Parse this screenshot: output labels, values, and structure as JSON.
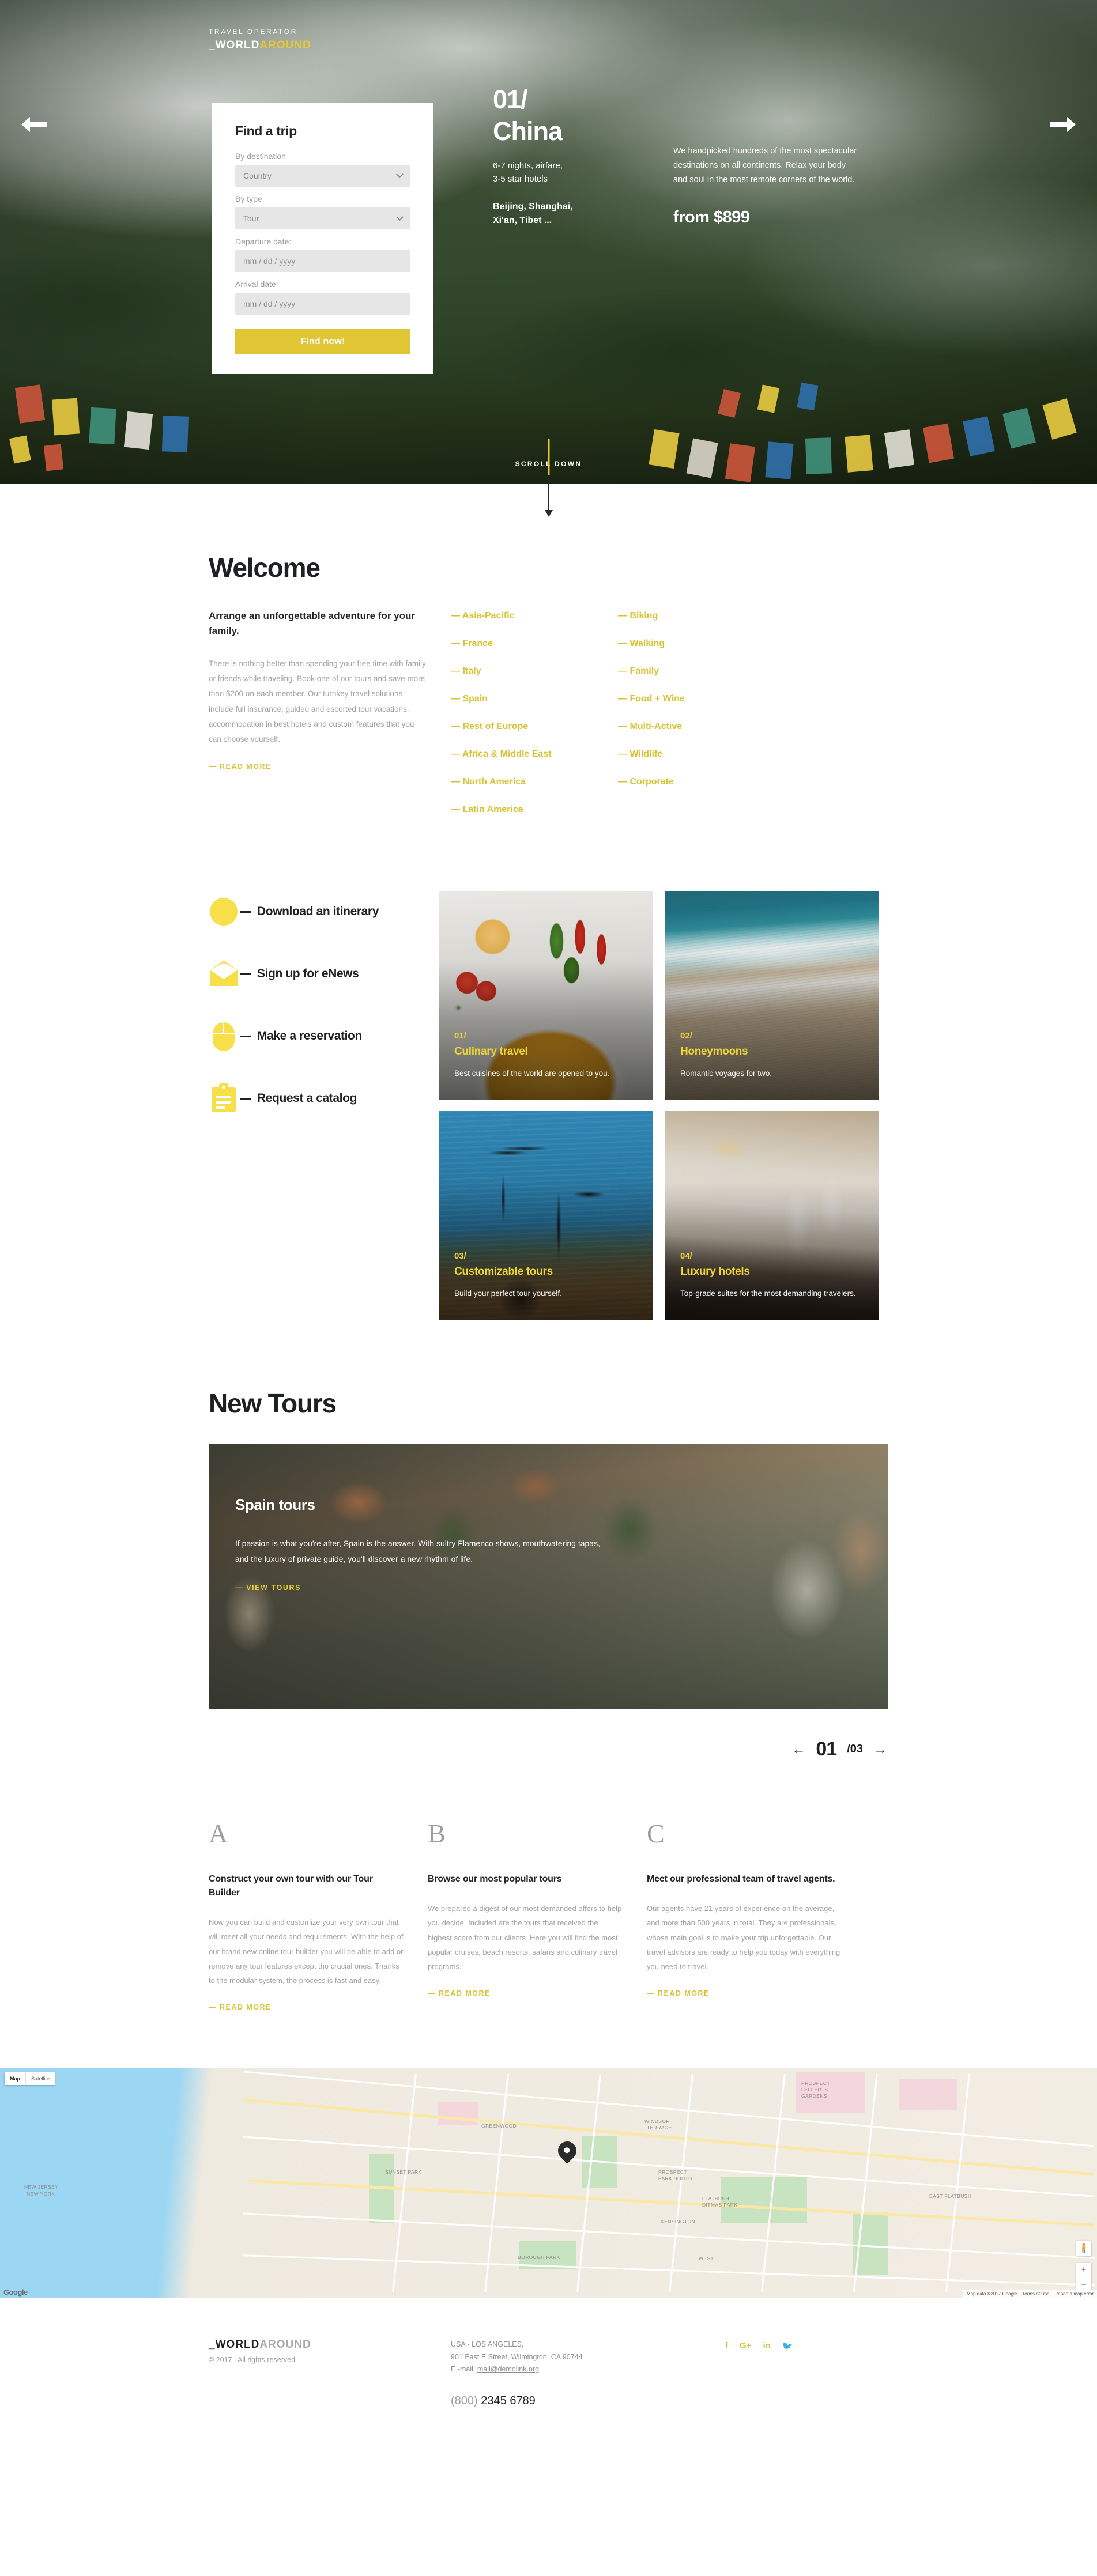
{
  "brand": {
    "kicker": "TRAVEL OPERATOR",
    "prefix": "_WORLD",
    "suffix": "AROUND"
  },
  "hero": {
    "prev_icon": "arrow-left-icon",
    "next_icon": "arrow-right-icon",
    "form": {
      "title": "Find a trip",
      "destination_label": "By destination",
      "destination_value": "Country",
      "type_label": "By type",
      "type_value": "Tour",
      "departure_label": "Departure date:",
      "departure_placeholder": "mm / dd / yyyy",
      "arrival_label": "Arrival date:",
      "arrival_placeholder": "mm / dd / yyyy",
      "submit": "Find now!"
    },
    "slide": {
      "number": "01/",
      "title": "China",
      "meta": "6-7 nights, airfare,\n3-5 star hotels",
      "cities": "Beijing, Shanghai,\nXi'an, Tibet ...",
      "description": "We handpicked hundreds of the most spectacular destinations on all continents. Relax your body and soul in the most remote corners of the world.",
      "price": "from $899"
    },
    "scroll_label": "SCROLL DOWN"
  },
  "welcome": {
    "heading": "Welcome",
    "subheading": "Arrange an unforgettable adventure for your family.",
    "body": "There is nothing better than spending your free time with family or friends while traveling. Book one of our tours and save more than $200 on each member. Our turnkey travel solutions include full insurance, guided and escorted tour vacations, accommodation in best hotels and custom features that you can choose yourself.",
    "read_more": "— READ MORE",
    "destinations": [
      "— Asia-Pacific",
      "— France",
      "— Italy",
      "— Spain",
      "— Rest of Europe",
      "— Africa & Middle East",
      "— North America",
      "— Latin America"
    ],
    "types": [
      "— Biking",
      "— Walking",
      "— Family",
      "— Food + Wine",
      "— Multi-Active",
      "— Wildlife",
      "— Corporate"
    ]
  },
  "services": [
    {
      "icon": "compass-icon",
      "label": "Download an itinerary"
    },
    {
      "icon": "envelope-icon",
      "label": "Sign up for eNews"
    },
    {
      "icon": "mouse-icon",
      "label": "Make a reservation"
    },
    {
      "icon": "clipboard-icon",
      "label": "Request a catalog"
    }
  ],
  "cards": [
    {
      "num": "01/",
      "title": "Culinary travel",
      "desc": "Best cuisines of the world are opened to you."
    },
    {
      "num": "02/",
      "title": "Honeymoons",
      "desc": "Romantic voyages for two."
    },
    {
      "num": "03/",
      "title": "Customizable tours",
      "desc": "Build your perfect tour yourself."
    },
    {
      "num": "04/",
      "title": "Luxury hotels",
      "desc": "Top-grade suites for the most demanding travelers."
    }
  ],
  "new_tours": {
    "heading": "New Tours",
    "slide_title": "Spain tours",
    "slide_body": "If passion is what you're after, Spain is the answer. With sultry Flamenco shows, mouthwatering tapas, and the luxury of private guide, you'll discover a new rhythm of life.",
    "view_link": "— VIEW TOURS",
    "prev_icon": "arrow-left-icon",
    "next_icon": "arrow-right-icon",
    "current": "01",
    "total": "/03"
  },
  "abc": [
    {
      "letter": "A",
      "title": "Construct your own tour with our Tour Builder",
      "body": "Now you can build and customize your very own tour that will meet all your needs and requirements. With the help of our brand new online tour builder you will be able to add or remove any tour features except the crucial ones. Thanks to the modular system, the process is fast and easy.",
      "link": "— READ MORE"
    },
    {
      "letter": "B",
      "title": "Browse our most popular tours",
      "body": "We prepared a digest of our most demanded offers to help you decide. Included are the tours that received the highest score from our clients. Here you will find the most popular cruises, beach resorts, safaris and culinary travel programs.",
      "link": "— READ MORE"
    },
    {
      "letter": "C",
      "title": "Meet our professional team of travel agents.",
      "body": "Our agents have 21 years of experience on the average, and more than 500 years in total. They are professionals, whose main goal is to make your trip unforgettable. Our travel advisors are ready to help you today with everything you need to travel.",
      "link": "— READ MORE"
    }
  ],
  "map": {
    "toggle_map": "Map",
    "toggle_satellite": "Satellite",
    "logo": "Google",
    "labels": [
      "NEW JERSEY",
      "NEW YORK",
      "GREENWOOD",
      "WINDSOR TERRACE",
      "PROSPECT LEFFERTS GARDENS",
      "PROSPECT PARK SOUTH",
      "SUNSET PARK",
      "KENSINGTON",
      "FLATBUSH DITMAS PARK",
      "EAST FLATBUSH",
      "WEST",
      "BOROUGH PARK"
    ],
    "attr_data": "Map data ©2017 Google",
    "attr_terms": "Terms of Use",
    "attr_report": "Report a map error",
    "pegman_icon": "pegman-icon",
    "zoom_in": "+",
    "zoom_out": "−"
  },
  "footer": {
    "copyright": "© 2017 | All rights reserved",
    "address_line1": "USA - LOS ANGELES,",
    "address_line2": "901 East E Street, Wilmington, CA 90744",
    "email_label": "E -mail:",
    "email": "mail@demolink.org",
    "phone_prefix": "(800)",
    "phone_number": "2345 6789",
    "social": [
      "f",
      "G+",
      "in",
      "🐦"
    ]
  }
}
